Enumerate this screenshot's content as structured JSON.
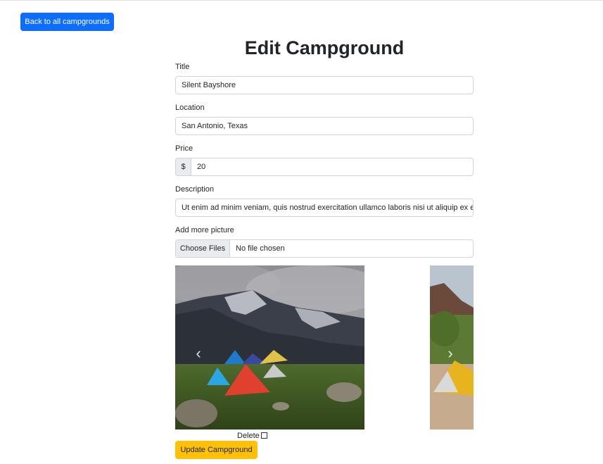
{
  "nav": {
    "back_label": "Back to all campgrounds"
  },
  "page": {
    "title": "Edit Campground"
  },
  "form": {
    "title_label": "Title",
    "title_value": "Silent Bayshore",
    "location_label": "Location",
    "location_value": "San Antonio, Texas",
    "price_label": "Price",
    "price_prefix": "$",
    "price_value": "20",
    "description_label": "Description",
    "description_value": "Ut enim ad minim veniam, quis nostrud exercitation ullamco laboris nisi ut aliquip ex ea",
    "pictures_label": "Add more picture",
    "file_button_label": "Choose Files",
    "file_status": "No file chosen",
    "delete_label": "Delete",
    "submit_label": "Update Campground"
  },
  "carousel": {
    "prev_icon": "chevron-left-icon",
    "next_icon": "chevron-right-icon",
    "prev_glyph": "‹",
    "next_glyph": "›"
  },
  "colors": {
    "primary": "#0d6efd",
    "warning": "#ffc107"
  }
}
